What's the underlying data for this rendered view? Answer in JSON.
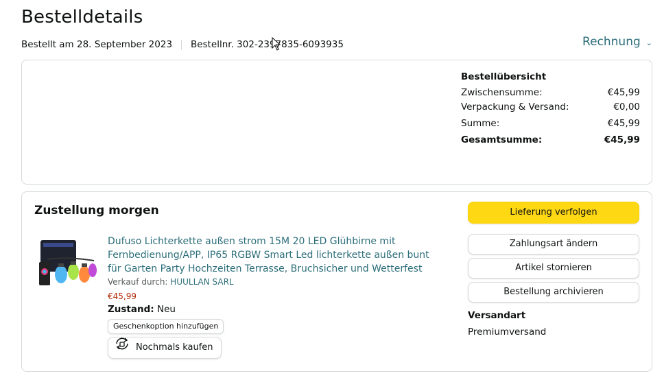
{
  "header": {
    "title": "Bestelldetails",
    "ordered_on": "Bestellt am 28. September 2023",
    "order_number": "Bestellnr. 302-2397835-6093935",
    "invoice_label": "Rechnung"
  },
  "summary": {
    "title": "Bestellübersicht",
    "rows": [
      {
        "label": "Zwischensumme:",
        "value": "€45,99"
      },
      {
        "label": "Verpackung & Versand:",
        "value": "€0,00"
      },
      {
        "label": "Summe:",
        "value": "€45,99"
      },
      {
        "label": "Gesamtsumme:",
        "value": "€45,99"
      }
    ]
  },
  "delivery": {
    "title": "Zustellung morgen",
    "product": {
      "title": "Dufuso Lichterkette außen strom 15M 20 LED Glühbirne mit Fernbedienung/APP, IP65 RGBW Smart Led lichterkette außen bunt für Garten Party Hochzeiten Terrasse, Bruchsicher und Wetterfest",
      "seller_prefix": "Verkauf durch:",
      "seller": "HUULLAN SARL",
      "price": "€45,99",
      "condition_label": "Zustand:",
      "condition_value": "Neu",
      "gift_label": "Geschenkoption hinzufügen",
      "rebuy_label": "Nochmals kaufen"
    },
    "actions": {
      "track": "Lieferung verfolgen",
      "change_payment": "Zahlungsart ändern",
      "cancel": "Artikel stornieren",
      "archive": "Bestellung archivieren"
    },
    "shipping_label": "Versandart",
    "shipping_value": "Premiumversand"
  },
  "colors": {
    "link": "#2c6e7a",
    "primary_button": "#FFD814",
    "price": "#B12704",
    "border": "#D5D9D9"
  }
}
